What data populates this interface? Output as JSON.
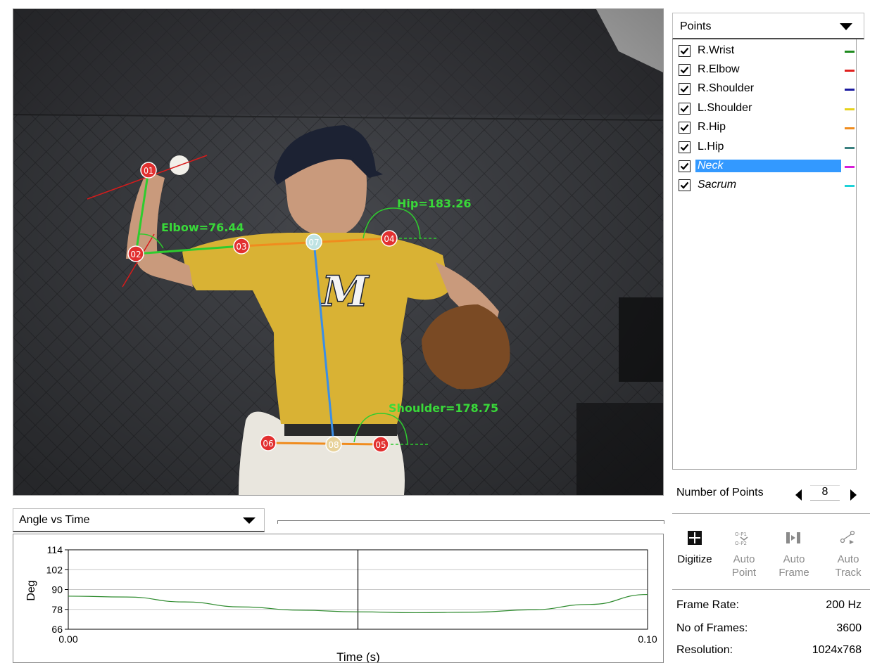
{
  "video": {
    "labels": {
      "elbow": "Elbow=76.44",
      "hip": "Hip=183.26",
      "shoulder": "Shoulder=178.75"
    },
    "markers": [
      "01",
      "02",
      "03",
      "04",
      "05",
      "06",
      "07",
      "08"
    ],
    "jersey_letter": "M"
  },
  "view_select": {
    "value": "Angle vs Time"
  },
  "chart_data": {
    "type": "line",
    "x": [
      0.0,
      0.01,
      0.02,
      0.03,
      0.04,
      0.05,
      0.06,
      0.07,
      0.08,
      0.09,
      0.1
    ],
    "series": [
      {
        "values": [
          86,
          85.5,
          82.5,
          79.5,
          77.5,
          76.5,
          76.0,
          76.3,
          77.8,
          81.0,
          87.0
        ],
        "color": "#2e8b2e"
      }
    ],
    "xlabel": "Time (s)",
    "ylabel": "Deg",
    "xlim": [
      0.0,
      0.1
    ],
    "ylim": [
      66,
      114
    ],
    "y_ticks": [
      "114",
      "102",
      "90",
      "78",
      "66"
    ],
    "x_tick_labels": [
      "0.00",
      "0.10"
    ],
    "cursor_x": 0.05,
    "grid": true
  },
  "points_panel": {
    "select_label": "Points",
    "items": [
      {
        "label": "R.Wrist",
        "color": "#1e8a1e",
        "checked": true
      },
      {
        "label": "R.Elbow",
        "color": "#e0201e",
        "checked": true
      },
      {
        "label": "R.Shoulder",
        "color": "#1a1aa0",
        "checked": true
      },
      {
        "label": "L.Shoulder",
        "color": "#e6d21a",
        "checked": true
      },
      {
        "label": "R.Hip",
        "color": "#f08c1e",
        "checked": true
      },
      {
        "label": "L.Hip",
        "color": "#3a8080",
        "checked": true
      },
      {
        "label": "Neck",
        "color": "#d81ed8",
        "checked": true,
        "selected": true
      },
      {
        "label": "Sacrum",
        "color": "#1ed2d8",
        "checked": true
      }
    ]
  },
  "number_of_points": {
    "label": "Number of Points",
    "value": "8"
  },
  "tools": [
    {
      "label_line1": "Digitize",
      "label_line2": "",
      "icon": "digitize-icon",
      "enabled": true
    },
    {
      "label_line1": "Auto",
      "label_line2": "Point",
      "icon": "auto-point-icon",
      "enabled": false
    },
    {
      "label_line1": "Auto",
      "label_line2": "Frame",
      "icon": "auto-frame-icon",
      "enabled": false
    },
    {
      "label_line1": "Auto",
      "label_line2": "Track",
      "icon": "auto-track-icon",
      "enabled": false
    }
  ],
  "info": {
    "frame_rate_label": "Frame Rate:",
    "frame_rate_value": "200 Hz",
    "frames_label": "No of Frames:",
    "frames_value": "3600",
    "resolution_label": "Resolution:",
    "resolution_value": "1024x768"
  }
}
